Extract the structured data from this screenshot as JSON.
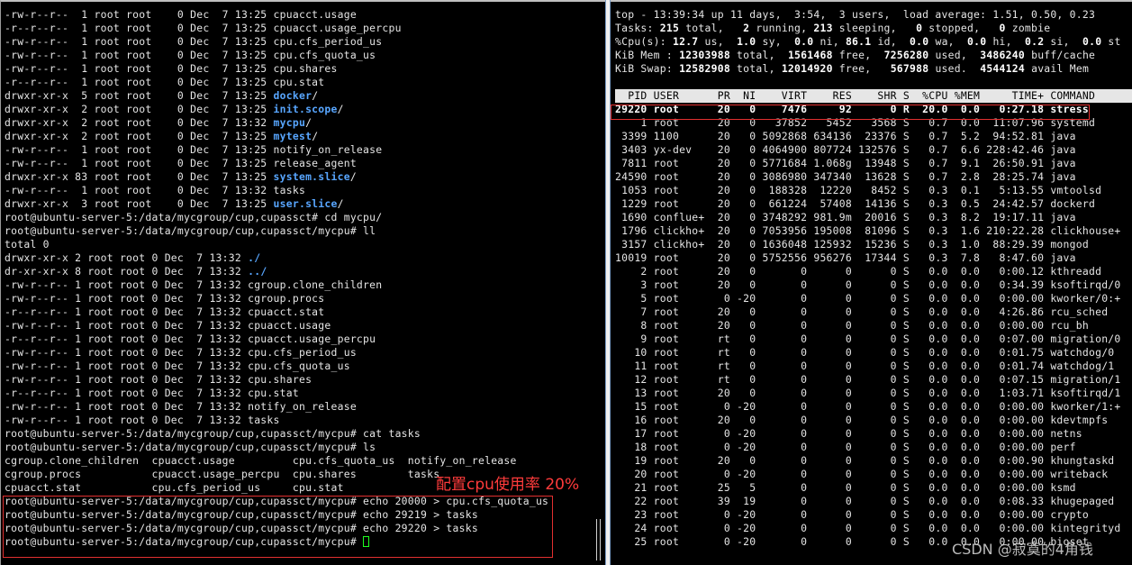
{
  "left_terminal": {
    "lines": [
      [
        {
          "t": "-rw-r--r--  1 root root    0 Dec  7 13:25 cpuacct.usage"
        }
      ],
      [
        {
          "t": "-r--r--r--  1 root root    0 Dec  7 13:25 cpuacct.usage_percpu"
        }
      ],
      [
        {
          "t": "-rw-r--r--  1 root root    0 Dec  7 13:25 cpu.cfs_period_us"
        }
      ],
      [
        {
          "t": "-rw-r--r--  1 root root    0 Dec  7 13:25 cpu.cfs_quota_us"
        }
      ],
      [
        {
          "t": "-rw-r--r--  1 root root    0 Dec  7 13:25 cpu.shares"
        }
      ],
      [
        {
          "t": "-r--r--r--  1 root root    0 Dec  7 13:25 cpu.stat"
        }
      ],
      [
        {
          "t": "drwxr-xr-x  5 root root    0 Dec  7 13:25 "
        },
        {
          "t": "docker",
          "c": "dir"
        },
        {
          "t": "/"
        }
      ],
      [
        {
          "t": "drwxr-xr-x  2 root root    0 Dec  7 13:25 "
        },
        {
          "t": "init.scope",
          "c": "dir"
        },
        {
          "t": "/"
        }
      ],
      [
        {
          "t": "drwxr-xr-x  2 root root    0 Dec  7 13:32 "
        },
        {
          "t": "mycpu",
          "c": "dir"
        },
        {
          "t": "/"
        }
      ],
      [
        {
          "t": "drwxr-xr-x  2 root root    0 Dec  7 13:25 "
        },
        {
          "t": "mytest",
          "c": "dir"
        },
        {
          "t": "/"
        }
      ],
      [
        {
          "t": "-rw-r--r--  1 root root    0 Dec  7 13:25 notify_on_release"
        }
      ],
      [
        {
          "t": "-rw-r--r--  1 root root    0 Dec  7 13:25 release_agent"
        }
      ],
      [
        {
          "t": "drwxr-xr-x 83 root root    0 Dec  7 13:25 "
        },
        {
          "t": "system.slice",
          "c": "dir"
        },
        {
          "t": "/"
        }
      ],
      [
        {
          "t": "-rw-r--r--  1 root root    0 Dec  7 13:32 tasks"
        }
      ],
      [
        {
          "t": "drwxr-xr-x  3 root root    0 Dec  7 13:25 "
        },
        {
          "t": "user.slice",
          "c": "dir"
        },
        {
          "t": "/"
        }
      ],
      [
        {
          "t": "root@ubuntu-server-5:/data/mycgroup/cup,cupassct# cd mycpu/"
        }
      ],
      [
        {
          "t": "root@ubuntu-server-5:/data/mycgroup/cup,cupassct/mycpu# ll"
        }
      ],
      [
        {
          "t": "total 0"
        }
      ],
      [
        {
          "t": "drwxr-xr-x 2 root root 0 Dec  7 13:32 "
        },
        {
          "t": "./",
          "c": "dir"
        }
      ],
      [
        {
          "t": "dr-xr-xr-x 8 root root 0 Dec  7 13:32 "
        },
        {
          "t": "../",
          "c": "dir"
        }
      ],
      [
        {
          "t": "-rw-r--r-- 1 root root 0 Dec  7 13:32 cgroup.clone_children"
        }
      ],
      [
        {
          "t": "-rw-r--r-- 1 root root 0 Dec  7 13:32 cgroup.procs"
        }
      ],
      [
        {
          "t": "-r--r--r-- 1 root root 0 Dec  7 13:32 cpuacct.stat"
        }
      ],
      [
        {
          "t": "-rw-r--r-- 1 root root 0 Dec  7 13:32 cpuacct.usage"
        }
      ],
      [
        {
          "t": "-r--r--r-- 1 root root 0 Dec  7 13:32 cpuacct.usage_percpu"
        }
      ],
      [
        {
          "t": "-rw-r--r-- 1 root root 0 Dec  7 13:32 cpu.cfs_period_us"
        }
      ],
      [
        {
          "t": "-rw-r--r-- 1 root root 0 Dec  7 13:32 cpu.cfs_quota_us"
        }
      ],
      [
        {
          "t": "-rw-r--r-- 1 root root 0 Dec  7 13:32 cpu.shares"
        }
      ],
      [
        {
          "t": "-r--r--r-- 1 root root 0 Dec  7 13:32 cpu.stat"
        }
      ],
      [
        {
          "t": "-rw-r--r-- 1 root root 0 Dec  7 13:32 notify_on_release"
        }
      ],
      [
        {
          "t": "-rw-r--r-- 1 root root 0 Dec  7 13:32 tasks"
        }
      ],
      [
        {
          "t": "root@ubuntu-server-5:/data/mycgroup/cup,cupassct/mycpu# cat tasks"
        }
      ],
      [
        {
          "t": "root@ubuntu-server-5:/data/mycgroup/cup,cupassct/mycpu# ls"
        }
      ],
      [
        {
          "t": "cgroup.clone_children  cpuacct.usage         cpu.cfs_quota_us  notify_on_release"
        }
      ],
      [
        {
          "t": "cgroup.procs           cpuacct.usage_percpu  cpu.shares        tasks"
        }
      ],
      [
        {
          "t": "cpuacct.stat           cpu.cfs_period_us     cpu.stat"
        }
      ],
      [
        {
          "t": "root@ubuntu-server-5:/data/mycgroup/cup,cupassct/mycpu# echo 20000 > cpu.cfs_quota_us"
        }
      ],
      [
        {
          "t": "root@ubuntu-server-5:/data/mycgroup/cup,cupassct/mycpu# echo 29219 > tasks"
        }
      ],
      [
        {
          "t": "root@ubuntu-server-5:/data/mycgroup/cup,cupassct/mycpu# echo 29220 > tasks"
        }
      ],
      [
        {
          "t": "root@ubuntu-server-5:/data/mycgroup/cup,cupassct/mycpu# "
        },
        {
          "c": "cursor"
        }
      ]
    ]
  },
  "top_terminal": {
    "lines": [
      [
        {
          "t": "top - 13:39:34 up 11 days,  3:54,  3 users,  load average: 1.51, 0.50, 0.23"
        }
      ],
      [
        {
          "t": "Tasks: "
        },
        {
          "t": "215",
          "c": "b"
        },
        {
          "t": " total,   "
        },
        {
          "t": "2",
          "c": "b"
        },
        {
          "t": " running, "
        },
        {
          "t": "213",
          "c": "b"
        },
        {
          "t": " sleeping,   "
        },
        {
          "t": "0",
          "c": "b"
        },
        {
          "t": " stopped,   "
        },
        {
          "t": "0",
          "c": "b"
        },
        {
          "t": " zombie"
        }
      ],
      [
        {
          "t": "%Cpu(s): "
        },
        {
          "t": "12.7",
          "c": "b"
        },
        {
          "t": " us,  "
        },
        {
          "t": "1.0",
          "c": "b"
        },
        {
          "t": " sy,  "
        },
        {
          "t": "0.0",
          "c": "b"
        },
        {
          "t": " ni, "
        },
        {
          "t": "86.1",
          "c": "b"
        },
        {
          "t": " id,  "
        },
        {
          "t": "0.0",
          "c": "b"
        },
        {
          "t": " wa,  "
        },
        {
          "t": "0.0",
          "c": "b"
        },
        {
          "t": " hi,  "
        },
        {
          "t": "0.2",
          "c": "b"
        },
        {
          "t": " si,  "
        },
        {
          "t": "0.0",
          "c": "b"
        },
        {
          "t": " st"
        }
      ],
      [
        {
          "t": "KiB Mem : "
        },
        {
          "t": "12303988",
          "c": "b"
        },
        {
          "t": " total,  "
        },
        {
          "t": "1561468",
          "c": "b"
        },
        {
          "t": " free,  "
        },
        {
          "t": "7256280",
          "c": "b"
        },
        {
          "t": " used,  "
        },
        {
          "t": "3486240",
          "c": "b"
        },
        {
          "t": " buff/cache"
        }
      ],
      [
        {
          "t": "KiB Swap: "
        },
        {
          "t": "12582908",
          "c": "b"
        },
        {
          "t": " total, "
        },
        {
          "t": "12014920",
          "c": "b"
        },
        {
          "t": " free,   "
        },
        {
          "t": "567988",
          "c": "b"
        },
        {
          "t": " used.  "
        },
        {
          "t": "4544124",
          "c": "b"
        },
        {
          "t": " avail Mem"
        }
      ],
      [
        {
          "t": " "
        }
      ],
      [
        {
          "t": "  PID USER      PR  NI    VIRT    RES    SHR S  %CPU %MEM     TIME+ COMMAND        ",
          "c": "hdr"
        }
      ],
      [
        {
          "t": "29220 root      20   0    7476     92      0 R  20.0  0.0   0:27.18 stress",
          "c": "b"
        }
      ],
      [
        {
          "t": "    1 root      20   0   37852   5452   3568 S   0.7  0.0  11:07.96 systemd"
        }
      ],
      [
        {
          "t": " 3399 1100      20   0 5092868 634136  23376 S   0.7  5.2  94:52.81 java"
        }
      ],
      [
        {
          "t": " 3403 yx-dev    20   0 4064900 807724 132576 S   0.7  6.6 228:42.46 java"
        }
      ],
      [
        {
          "t": " 7811 root      20   0 5771684 1.068g  13948 S   0.7  9.1  26:50.91 java"
        }
      ],
      [
        {
          "t": "24590 root      20   0 3086980 347340  13628 S   0.7  2.8  28:25.74 java"
        }
      ],
      [
        {
          "t": " 1053 root      20   0  188328  12220   8452 S   0.3  0.1   5:13.55 vmtoolsd"
        }
      ],
      [
        {
          "t": " 1229 root      20   0  661224  57408  14136 S   0.3  0.5  24:42.57 dockerd"
        }
      ],
      [
        {
          "t": " 1690 conflue+  20   0 3748292 981.9m  20016 S   0.3  8.2  19:17.11 java"
        }
      ],
      [
        {
          "t": " 1796 clickho+  20   0 7053956 195008  81096 S   0.3  1.6 210:22.28 clickhouse+"
        }
      ],
      [
        {
          "t": " 3157 clickho+  20   0 1636048 125932  15236 S   0.3  1.0  88:29.39 mongod"
        }
      ],
      [
        {
          "t": "10019 root      20   0 5752556 956276  17344 S   0.3  7.8   8:47.60 java"
        }
      ],
      [
        {
          "t": "    2 root      20   0       0      0      0 S   0.0  0.0   0:00.12 kthreadd"
        }
      ],
      [
        {
          "t": "    3 root      20   0       0      0      0 S   0.0  0.0   0:34.39 ksoftirqd/0"
        }
      ],
      [
        {
          "t": "    5 root       0 -20       0      0      0 S   0.0  0.0   0:00.00 kworker/0:+"
        }
      ],
      [
        {
          "t": "    7 root      20   0       0      0      0 S   0.0  0.0   4:26.86 rcu_sched"
        }
      ],
      [
        {
          "t": "    8 root      20   0       0      0      0 S   0.0  0.0   0:00.00 rcu_bh"
        }
      ],
      [
        {
          "t": "    9 root      rt   0       0      0      0 S   0.0  0.0   0:07.00 migration/0"
        }
      ],
      [
        {
          "t": "   10 root      rt   0       0      0      0 S   0.0  0.0   0:01.75 watchdog/0"
        }
      ],
      [
        {
          "t": "   11 root      rt   0       0      0      0 S   0.0  0.0   0:01.74 watchdog/1"
        }
      ],
      [
        {
          "t": "   12 root      rt   0       0      0      0 S   0.0  0.0   0:07.15 migration/1"
        }
      ],
      [
        {
          "t": "   13 root      20   0       0      0      0 S   0.0  0.0   1:03.71 ksoftirqd/1"
        }
      ],
      [
        {
          "t": "   15 root       0 -20       0      0      0 S   0.0  0.0   0:00.00 kworker/1:+"
        }
      ],
      [
        {
          "t": "   16 root      20   0       0      0      0 S   0.0  0.0   0:00.00 kdevtmpfs"
        }
      ],
      [
        {
          "t": "   17 root       0 -20       0      0      0 S   0.0  0.0   0:00.00 netns"
        }
      ],
      [
        {
          "t": "   18 root       0 -20       0      0      0 S   0.0  0.0   0:00.00 perf"
        }
      ],
      [
        {
          "t": "   19 root      20   0       0      0      0 S   0.0  0.0   0:00.90 khungtaskd"
        }
      ],
      [
        {
          "t": "   20 root       0 -20       0      0      0 S   0.0  0.0   0:00.00 writeback"
        }
      ],
      [
        {
          "t": "   21 root      25   5       0      0      0 S   0.0  0.0   0:00.00 ksmd"
        }
      ],
      [
        {
          "t": "   22 root      39  19       0      0      0 S   0.0  0.0   0:08.33 khugepaged"
        }
      ],
      [
        {
          "t": "   23 root       0 -20       0      0      0 S   0.0  0.0   0:00.00 crypto"
        }
      ],
      [
        {
          "t": "   24 root       0 -20       0      0      0 S   0.0  0.0   0:00.00 kintegrityd"
        }
      ],
      [
        {
          "t": "   25 root       0 -20       0      0      0 S   0.0  0.0   0:00.00 bioset"
        }
      ]
    ]
  },
  "annotation": {
    "text": "配置cpu使用率 20%"
  },
  "watermark": {
    "text": "CSDN @寂寞的4角钱"
  },
  "colors": {
    "highlight_box": "#e23030",
    "directory": "#58a6ff",
    "cursor": "#1eff1e"
  }
}
